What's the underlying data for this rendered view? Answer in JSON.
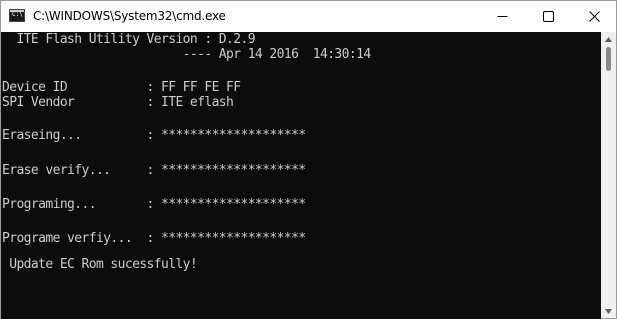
{
  "window": {
    "title": "C:\\WINDOWS\\System32\\cmd.exe",
    "icon": "cmd-icon",
    "icon_text": "C:\\",
    "controls": [
      "minimize-icon",
      "maximize-icon",
      "close-icon"
    ]
  },
  "console": {
    "lines": [
      "  ITE Flash Utility Version : D.2.9",
      "                         ---- Apr 14 2016  14:30:14",
      "",
      "Device ID           : FF FF FE FF",
      "SPI Vendor          : ITE eflash",
      "",
      "Eraseing...         : ********************",
      "",
      "Erase verify...     : ********************",
      "",
      "Programing...       : ********************",
      "",
      "Programe verfiy...  : ********************",
      "",
      " Update EC Rom sucessfully!"
    ],
    "text_color": "#cccccc",
    "background": "#0c0c0c"
  }
}
